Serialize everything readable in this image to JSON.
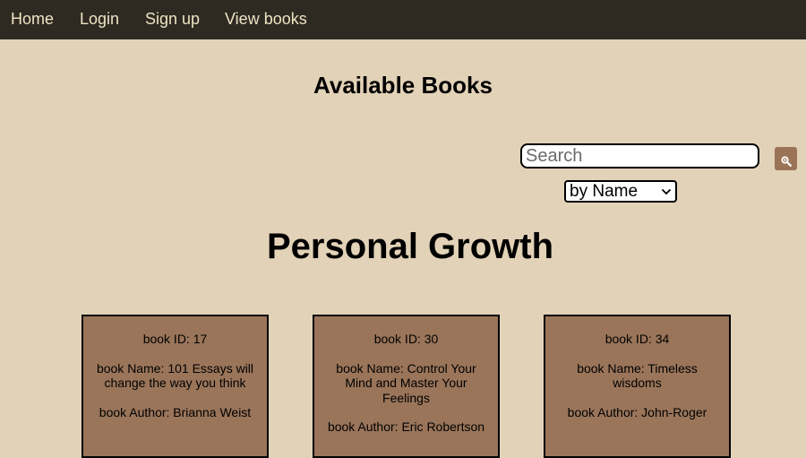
{
  "nav": {
    "items": [
      {
        "label": "Home"
      },
      {
        "label": "Login"
      },
      {
        "label": "Sign up"
      },
      {
        "label": "View books"
      }
    ]
  },
  "page": {
    "title": "Available Books",
    "category_title": "Personal Growth"
  },
  "search": {
    "placeholder": "Search",
    "value": "",
    "button_icon": "search-icon"
  },
  "sort": {
    "selected": "by Name",
    "icon": "chevron-down-icon"
  },
  "books": [
    {
      "id_text": "book ID: 17",
      "name_text": "book Name: 101 Essays will change the way you think",
      "author_text": "book Author: Brianna Weist"
    },
    {
      "id_text": "book ID: 30",
      "name_text": "book Name: Control Your Mind and Master Your Feelings",
      "author_text": "book Author: Eric Robertson"
    },
    {
      "id_text": "book ID: 34",
      "name_text": "book Name: Timeless wisdoms",
      "author_text": "book Author: John-Roger"
    }
  ],
  "colors": {
    "nav_background": "#2e2a22",
    "nav_text": "#efe3c4",
    "page_background": "#e2d2b7",
    "card_background": "#9a755a",
    "search_button": "#9b7457"
  }
}
